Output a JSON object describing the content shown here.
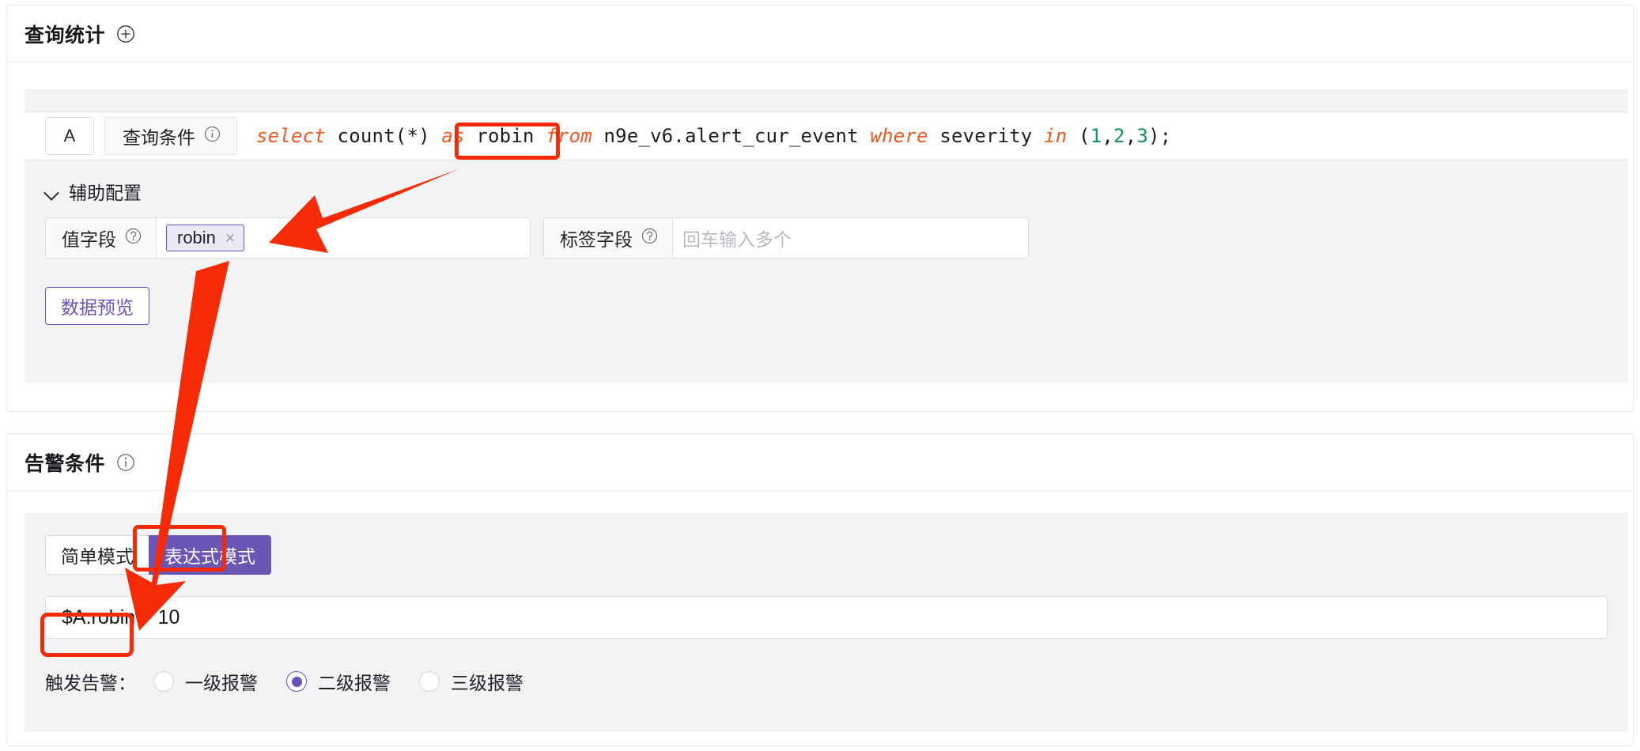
{
  "query_card": {
    "title": "查询统计",
    "add_icon": "plus-circle-icon",
    "ref_label": "A",
    "condition_label": "查询条件",
    "condition_info_icon": "info-circle-icon",
    "sql": {
      "full": "select count(*) as robin from n9e_v6.alert_cur_event where severity in (1,2,3);",
      "tokens": {
        "select": "select",
        "count": " count(*) ",
        "as": "as",
        "alias": " robin ",
        "from": "from",
        "table": " n9e_v6.alert_cur_event ",
        "where": "where",
        "column": " severity ",
        "in": "in",
        "open_paren": " (",
        "n1": "1",
        "c1": ",",
        "n2": "2",
        "c2": ",",
        "n3": "3",
        "close_paren": ");"
      }
    },
    "aux_section": {
      "chevron_icon": "chevron-down-icon",
      "title": "辅助配置",
      "value_field": {
        "label": "值字段",
        "help_icon": "question-circle-icon",
        "tags": [
          "robin"
        ],
        "tag_close_icon": "×"
      },
      "tag_field": {
        "label": "标签字段",
        "help_icon": "question-circle-icon",
        "placeholder": "回车输入多个",
        "value": ""
      }
    },
    "preview_button": "数据预览"
  },
  "alert_card": {
    "title": "告警条件",
    "info_icon": "info-circle-icon",
    "modes": [
      {
        "label": "简单模式",
        "active": false
      },
      {
        "label": "表达式模式",
        "active": true
      }
    ],
    "expression": "$A.robin > 10",
    "trigger": {
      "label": "触发告警：",
      "options": [
        {
          "label": "一级报警",
          "selected": false
        },
        {
          "label": "二级报警",
          "selected": true
        },
        {
          "label": "三级报警",
          "selected": false
        }
      ]
    }
  },
  "colors": {
    "accent_purple": "#6b51bb",
    "active_mode_bg": "#6b55b5",
    "annotation_red": "#f62a05",
    "sql_keyword": "#f4571f",
    "sql_number": "#0d9553",
    "panel_gray": "#f2f3f5"
  },
  "annotations": {
    "boxes": [
      {
        "name": "as-robin-highlight",
        "target": "as robin"
      },
      {
        "name": "expression-mode-highlight",
        "target": "表达式模式"
      },
      {
        "name": "expression-variable-highlight",
        "target": "$A.robin"
      }
    ],
    "arrows": [
      {
        "name": "arrow-to-value-field",
        "from": "as robin",
        "to": "值字段 robin tag"
      },
      {
        "name": "arrow-to-expression",
        "from": "值字段 robin tag",
        "to": "$A.robin"
      }
    ]
  }
}
